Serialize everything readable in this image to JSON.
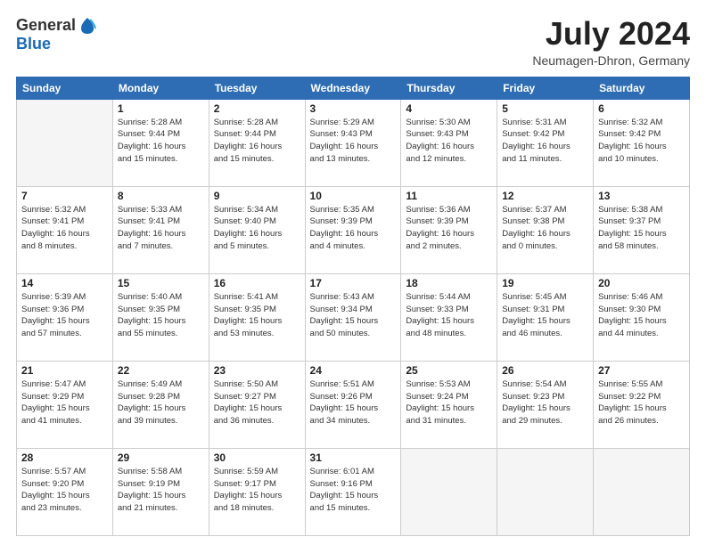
{
  "header": {
    "logo_general": "General",
    "logo_blue": "Blue",
    "month_title": "July 2024",
    "location": "Neumagen-Dhron, Germany"
  },
  "weekdays": [
    "Sunday",
    "Monday",
    "Tuesday",
    "Wednesday",
    "Thursday",
    "Friday",
    "Saturday"
  ],
  "weeks": [
    [
      {
        "day": "",
        "info": ""
      },
      {
        "day": "1",
        "info": "Sunrise: 5:28 AM\nSunset: 9:44 PM\nDaylight: 16 hours\nand 15 minutes."
      },
      {
        "day": "2",
        "info": "Sunrise: 5:28 AM\nSunset: 9:44 PM\nDaylight: 16 hours\nand 15 minutes."
      },
      {
        "day": "3",
        "info": "Sunrise: 5:29 AM\nSunset: 9:43 PM\nDaylight: 16 hours\nand 13 minutes."
      },
      {
        "day": "4",
        "info": "Sunrise: 5:30 AM\nSunset: 9:43 PM\nDaylight: 16 hours\nand 12 minutes."
      },
      {
        "day": "5",
        "info": "Sunrise: 5:31 AM\nSunset: 9:42 PM\nDaylight: 16 hours\nand 11 minutes."
      },
      {
        "day": "6",
        "info": "Sunrise: 5:32 AM\nSunset: 9:42 PM\nDaylight: 16 hours\nand 10 minutes."
      }
    ],
    [
      {
        "day": "7",
        "info": "Sunrise: 5:32 AM\nSunset: 9:41 PM\nDaylight: 16 hours\nand 8 minutes."
      },
      {
        "day": "8",
        "info": "Sunrise: 5:33 AM\nSunset: 9:41 PM\nDaylight: 16 hours\nand 7 minutes."
      },
      {
        "day": "9",
        "info": "Sunrise: 5:34 AM\nSunset: 9:40 PM\nDaylight: 16 hours\nand 5 minutes."
      },
      {
        "day": "10",
        "info": "Sunrise: 5:35 AM\nSunset: 9:39 PM\nDaylight: 16 hours\nand 4 minutes."
      },
      {
        "day": "11",
        "info": "Sunrise: 5:36 AM\nSunset: 9:39 PM\nDaylight: 16 hours\nand 2 minutes."
      },
      {
        "day": "12",
        "info": "Sunrise: 5:37 AM\nSunset: 9:38 PM\nDaylight: 16 hours\nand 0 minutes."
      },
      {
        "day": "13",
        "info": "Sunrise: 5:38 AM\nSunset: 9:37 PM\nDaylight: 15 hours\nand 58 minutes."
      }
    ],
    [
      {
        "day": "14",
        "info": "Sunrise: 5:39 AM\nSunset: 9:36 PM\nDaylight: 15 hours\nand 57 minutes."
      },
      {
        "day": "15",
        "info": "Sunrise: 5:40 AM\nSunset: 9:35 PM\nDaylight: 15 hours\nand 55 minutes."
      },
      {
        "day": "16",
        "info": "Sunrise: 5:41 AM\nSunset: 9:35 PM\nDaylight: 15 hours\nand 53 minutes."
      },
      {
        "day": "17",
        "info": "Sunrise: 5:43 AM\nSunset: 9:34 PM\nDaylight: 15 hours\nand 50 minutes."
      },
      {
        "day": "18",
        "info": "Sunrise: 5:44 AM\nSunset: 9:33 PM\nDaylight: 15 hours\nand 48 minutes."
      },
      {
        "day": "19",
        "info": "Sunrise: 5:45 AM\nSunset: 9:31 PM\nDaylight: 15 hours\nand 46 minutes."
      },
      {
        "day": "20",
        "info": "Sunrise: 5:46 AM\nSunset: 9:30 PM\nDaylight: 15 hours\nand 44 minutes."
      }
    ],
    [
      {
        "day": "21",
        "info": "Sunrise: 5:47 AM\nSunset: 9:29 PM\nDaylight: 15 hours\nand 41 minutes."
      },
      {
        "day": "22",
        "info": "Sunrise: 5:49 AM\nSunset: 9:28 PM\nDaylight: 15 hours\nand 39 minutes."
      },
      {
        "day": "23",
        "info": "Sunrise: 5:50 AM\nSunset: 9:27 PM\nDaylight: 15 hours\nand 36 minutes."
      },
      {
        "day": "24",
        "info": "Sunrise: 5:51 AM\nSunset: 9:26 PM\nDaylight: 15 hours\nand 34 minutes."
      },
      {
        "day": "25",
        "info": "Sunrise: 5:53 AM\nSunset: 9:24 PM\nDaylight: 15 hours\nand 31 minutes."
      },
      {
        "day": "26",
        "info": "Sunrise: 5:54 AM\nSunset: 9:23 PM\nDaylight: 15 hours\nand 29 minutes."
      },
      {
        "day": "27",
        "info": "Sunrise: 5:55 AM\nSunset: 9:22 PM\nDaylight: 15 hours\nand 26 minutes."
      }
    ],
    [
      {
        "day": "28",
        "info": "Sunrise: 5:57 AM\nSunset: 9:20 PM\nDaylight: 15 hours\nand 23 minutes."
      },
      {
        "day": "29",
        "info": "Sunrise: 5:58 AM\nSunset: 9:19 PM\nDaylight: 15 hours\nand 21 minutes."
      },
      {
        "day": "30",
        "info": "Sunrise: 5:59 AM\nSunset: 9:17 PM\nDaylight: 15 hours\nand 18 minutes."
      },
      {
        "day": "31",
        "info": "Sunrise: 6:01 AM\nSunset: 9:16 PM\nDaylight: 15 hours\nand 15 minutes."
      },
      {
        "day": "",
        "info": ""
      },
      {
        "day": "",
        "info": ""
      },
      {
        "day": "",
        "info": ""
      }
    ]
  ]
}
